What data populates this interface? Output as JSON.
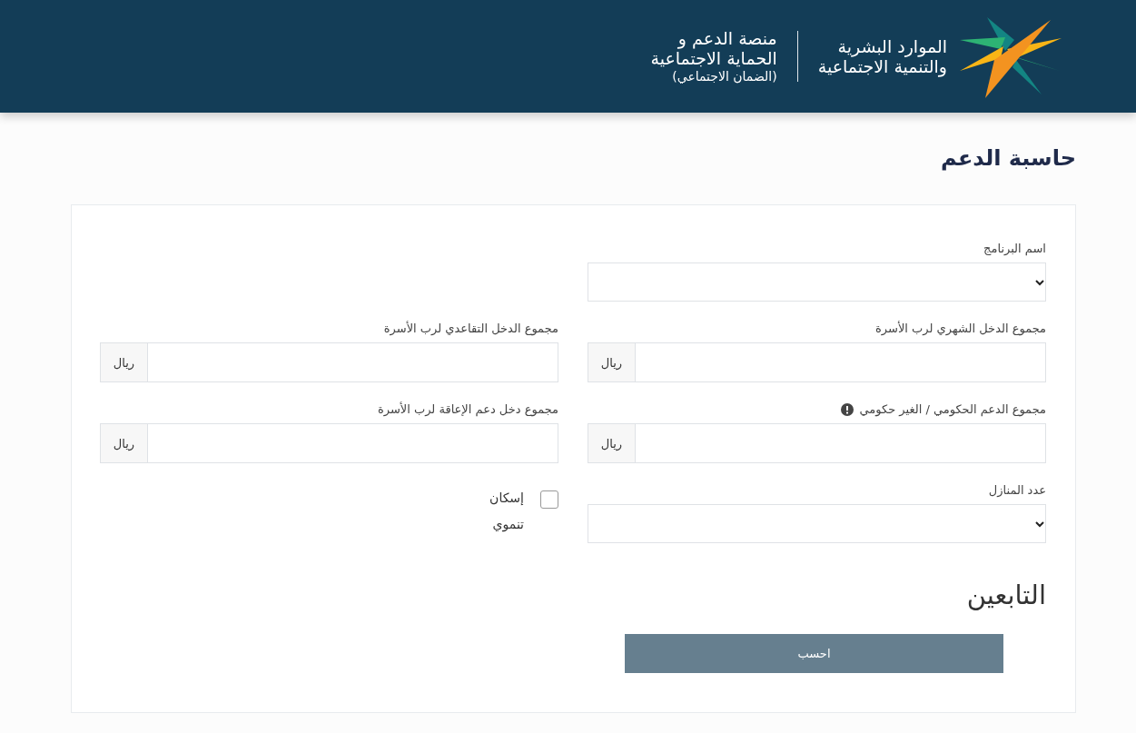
{
  "header": {
    "ministry_name": [
      "الموارد البشرية",
      "والتنمية الاجتماعية"
    ],
    "platform_name": [
      "منصة الدعم و",
      "الحماية الاجتماعية"
    ],
    "platform_subtitle": "(الضمان الاجتماعي)"
  },
  "page_title": "حاسبة الدعم",
  "form_rows": [
    {
      "cells": [
        {
          "kind": "select",
          "label": "اسم البرنامج"
        }
      ]
    },
    {
      "cells": [
        {
          "kind": "currency",
          "label": "مجموع الدخل الشهري لرب الأسرة",
          "unit": "ريال"
        },
        {
          "kind": "currency",
          "label": "مجموع الدخل التقاعدي لرب الأسرة",
          "unit": "ريال"
        }
      ]
    },
    {
      "cells": [
        {
          "kind": "currency",
          "label": "مجموع الدعم الحكومي / الغير حكومي",
          "unit": "ريال",
          "info": true
        },
        {
          "kind": "currency",
          "label": "مجموع دخل دعم الإعاقة لرب الأسرة",
          "unit": "ريال"
        }
      ]
    },
    {
      "cells": [
        {
          "kind": "select",
          "label": "عدد المنازل"
        },
        {
          "kind": "checkbox",
          "label": "إسكان تنموي",
          "checked": false
        }
      ]
    }
  ],
  "dependents_heading": "التابعين",
  "calculate_button": "احسب"
}
